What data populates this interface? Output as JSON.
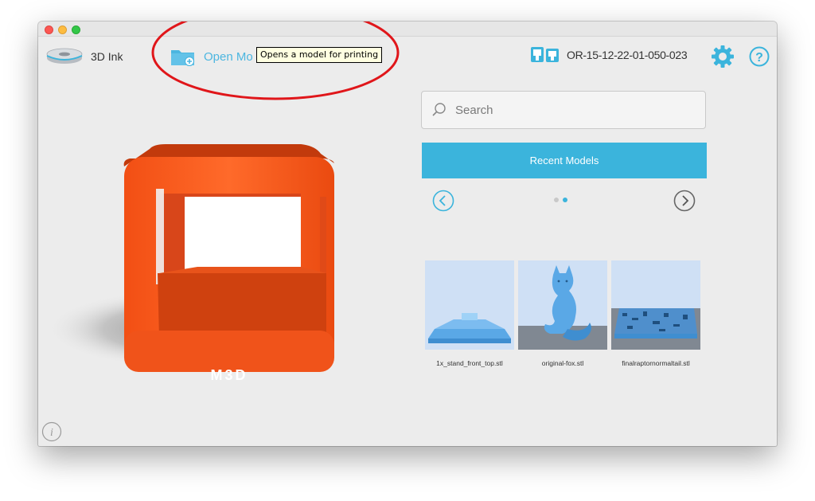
{
  "toolbar": {
    "ink_label": "3D Ink",
    "open_label": "Open Mo",
    "tooltip": "Opens a model for printing",
    "serial": "OR-15-12-22-01-050-023"
  },
  "search": {
    "placeholder": "Search"
  },
  "recent": {
    "title": "Recent Models",
    "page_count": 2,
    "active_page": 2,
    "models": [
      {
        "label": "1x_stand_front_top.stl"
      },
      {
        "label": "original-fox.stl"
      },
      {
        "label": "finalraptornormaltail.stl"
      }
    ]
  },
  "printer_model": {
    "logo_text": "M3D"
  },
  "colors": {
    "accent": "#3bb4dc",
    "printer_orange": "#ff5a1f",
    "annotation_red": "#e0161a",
    "thumb_bg": "#cfe0f5",
    "model_blue": "#5aa8e6"
  },
  "icons": {
    "ink": "filament-spool-icon",
    "open": "folder-plus-icon",
    "printer": "printer-status-icon",
    "settings": "gear-icon",
    "help": "help-icon",
    "search": "search-icon",
    "prev": "chevron-left-circle-icon",
    "next": "chevron-right-circle-icon",
    "info": "info-icon"
  }
}
